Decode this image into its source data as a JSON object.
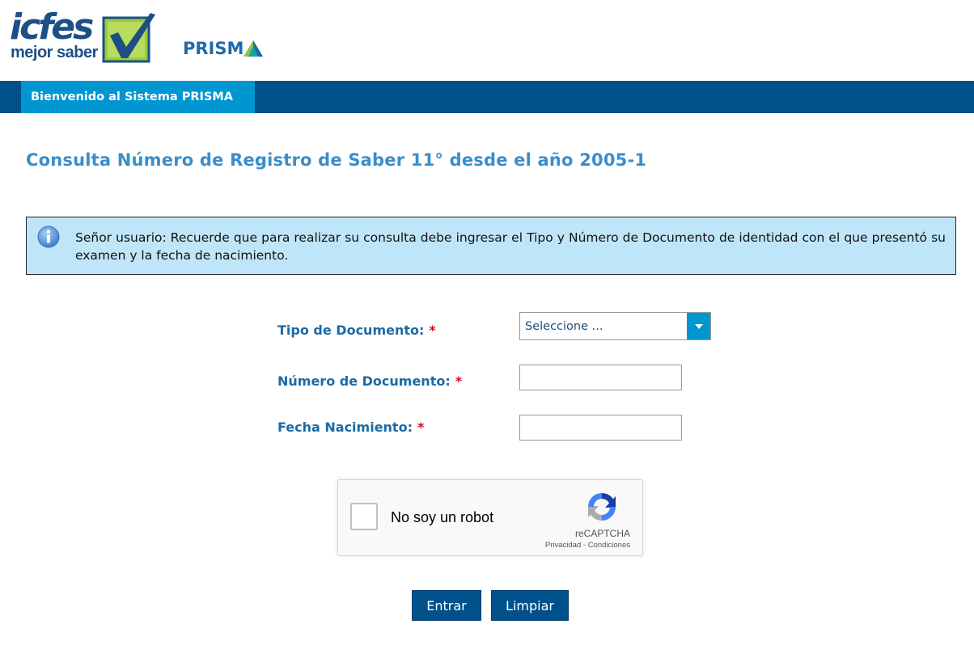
{
  "header": {
    "icfes_logo_word": "icfes",
    "icfes_logo_tagline": "mejor saber",
    "prisma_logo_text": "PRISM"
  },
  "nav": {
    "active_tab": "Bienvenido al Sistema PRISMA"
  },
  "page": {
    "title": "Consulta Número de Registro de Saber 11° desde el año 2005-1"
  },
  "info": {
    "icon": "info-icon",
    "message": "Señor usuario: Recuerde que para realizar su consulta debe ingresar el Tipo y Número de Documento de identidad con el que presentó su examen y la fecha de nacimiento."
  },
  "form": {
    "required_mark": "*",
    "doc_type": {
      "label": "Tipo de Documento:",
      "selected": "Seleccione ..."
    },
    "doc_number": {
      "label": "Número de Documento:",
      "value": ""
    },
    "birth_date": {
      "label": "Fecha Nacimiento:",
      "value": ""
    }
  },
  "recaptcha": {
    "label": "No soy un robot",
    "brand": "reCAPTCHA",
    "privacy": "Privacidad",
    "separator": " - ",
    "terms": "Condiciones"
  },
  "buttons": {
    "submit": "Entrar",
    "clear": "Limpiar"
  },
  "colors": {
    "nav_bar": "#00508c",
    "nav_tab": "#0096d2",
    "title": "#3a8ecb",
    "info_bg": "#bfe6f8",
    "label": "#1b6aa5",
    "required": "#e0001b",
    "button": "#00508c"
  }
}
